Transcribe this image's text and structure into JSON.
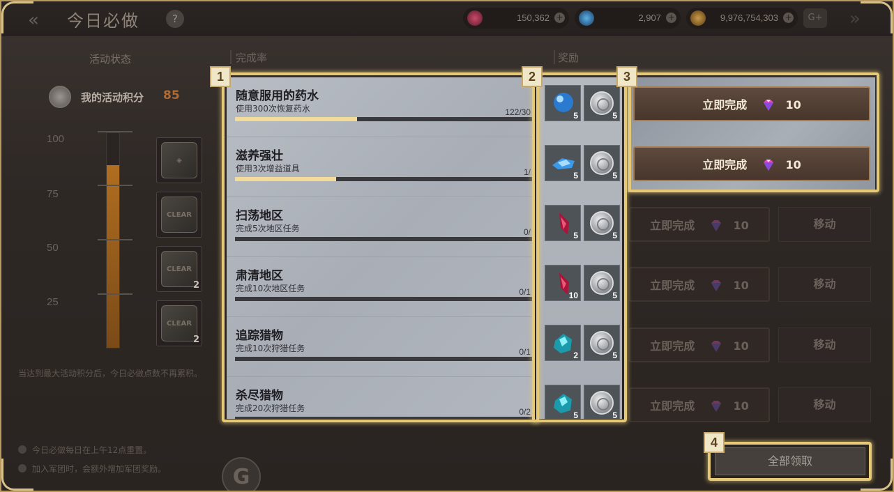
{
  "header": {
    "title": "今日必做",
    "help_label": "?",
    "currencies": [
      {
        "icon": "red-gem-icon",
        "value": "150,362"
      },
      {
        "icon": "blue-gem-icon",
        "value": "2,907"
      },
      {
        "icon": "gold-coin-icon",
        "value": "9,976,754,303"
      }
    ],
    "gplus_label": "G+"
  },
  "left": {
    "section_title": "活动状态",
    "score_label": "我的活动积分",
    "score_value": "85",
    "score_level": 85,
    "ticks": [
      "100",
      "75",
      "50",
      "25"
    ],
    "milestones": [
      {
        "icon": "shield-card-icon",
        "label": "",
        "count": ""
      },
      {
        "icon": "clear-badge-icon",
        "label": "CLEAR",
        "count": ""
      },
      {
        "icon": "clear-potion-icon",
        "label": "CLEAR",
        "count": "2"
      },
      {
        "icon": "clear-potion-icon",
        "label": "CLEAR",
        "count": "2"
      }
    ],
    "note": "当达到最大活动积分后，今日必做点数不再累积。",
    "tips": [
      "今日必做每日在上午12点重置。",
      "加入军团时，会额外增加军团奖励。"
    ],
    "g_label": "G"
  },
  "columns": {
    "completion": "完成率",
    "reward": "奖励"
  },
  "tasks": [
    {
      "name": "随意服用的药水",
      "desc": "使用300次恢复药水",
      "progress": "122/30",
      "fill": 0.41,
      "item_icon": "blue-orb-icon",
      "item_count": "5",
      "coin_count": "5"
    },
    {
      "name": "滋养强壮",
      "desc": "使用3次增益道具",
      "progress": "1/",
      "fill": 0.34,
      "item_icon": "blue-crystal-icon",
      "item_count": "5",
      "coin_count": "5"
    },
    {
      "name": "扫荡地区",
      "desc": "完成5次地区任务",
      "progress": "0/",
      "fill": 0,
      "item_icon": "red-shard-icon",
      "item_count": "5",
      "coin_count": "5"
    },
    {
      "name": "肃清地区",
      "desc": "完成10次地区任务",
      "progress": "0/1",
      "fill": 0,
      "item_icon": "red-shard-icon",
      "item_count": "10",
      "coin_count": "5"
    },
    {
      "name": "追踪猎物",
      "desc": "完成10次狩猎任务",
      "progress": "0/1",
      "fill": 0,
      "item_icon": "cyan-ore-icon",
      "item_count": "2",
      "coin_count": "5"
    },
    {
      "name": "杀尽猎物",
      "desc": "完成20次狩猎任务",
      "progress": "0/2",
      "fill": 0,
      "item_icon": "cyan-ore-icon",
      "item_count": "5",
      "coin_count": "5"
    }
  ],
  "actions": [
    {
      "complete_label": "立即完成",
      "cost": "10",
      "move_label": ""
    },
    {
      "complete_label": "立即完成",
      "cost": "10",
      "move_label": ""
    },
    {
      "complete_label": "立即完成",
      "cost": "10",
      "move_label": "移动"
    },
    {
      "complete_label": "立即完成",
      "cost": "10",
      "move_label": "移动"
    },
    {
      "complete_label": "立即完成",
      "cost": "10",
      "move_label": "移动"
    },
    {
      "complete_label": "立即完成",
      "cost": "10",
      "move_label": "移动"
    }
  ],
  "claim_all_label": "全部领取",
  "highlights": [
    "1",
    "2",
    "3",
    "4"
  ],
  "colors": {
    "accent_gold": "#e6c976",
    "progress": "#f3dc9a",
    "score": "#b06a32"
  }
}
